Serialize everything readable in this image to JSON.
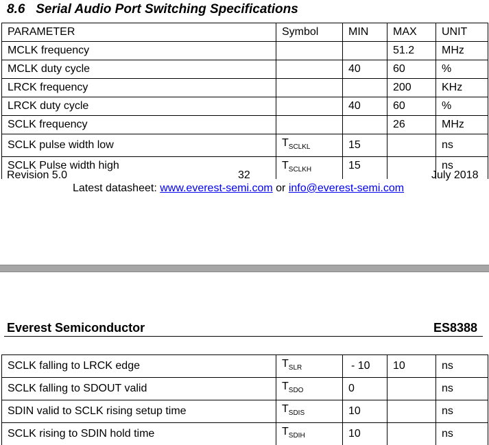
{
  "section_title": "8.6   Serial Audio Port Switching Specifications",
  "columns": [
    "PARAMETER",
    "Symbol",
    "MIN",
    "MAX",
    "UNIT"
  ],
  "top_rows": [
    {
      "param": "MCLK frequency",
      "sym": "",
      "sub": "",
      "min": "",
      "max": "51.2",
      "unit": "MHz"
    },
    {
      "param": "MCLK duty cycle",
      "sym": "",
      "sub": "",
      "min": "40",
      "max": "60",
      "unit": "%"
    },
    {
      "param": "LRCK frequency",
      "sym": "",
      "sub": "",
      "min": "",
      "max": "200",
      "unit": "KHz"
    },
    {
      "param": "LRCK duty cycle",
      "sym": "",
      "sub": "",
      "min": "40",
      "max": "60",
      "unit": "%"
    },
    {
      "param": "SCLK frequency",
      "sym": "",
      "sub": "",
      "min": "",
      "max": "26",
      "unit": "MHz"
    },
    {
      "param": "SCLK pulse width low",
      "sym": "T",
      "sub": "SCLKL",
      "min": "15",
      "max": "",
      "unit": "ns"
    },
    {
      "param": "SCLK Pulse width high",
      "sym": "T",
      "sub": "SCLKH",
      "min": "15",
      "max": "",
      "unit": "ns"
    }
  ],
  "footer": {
    "revision": "Revision 5.0",
    "page": "32",
    "date": "July 2018",
    "latest_prefix": "Latest datasheet: ",
    "website": "www.everest-semi.com",
    "or_text": " or ",
    "email": "info@everest-semi.com"
  },
  "header": {
    "company": "Everest Semiconductor",
    "part": "ES8388"
  },
  "bottom_rows": [
    {
      "param": "SCLK falling to LRCK edge",
      "sym": "T",
      "sub": "SLR",
      "min": "- 10",
      "max": "10",
      "unit": "ns"
    },
    {
      "param": "SCLK falling to SDOUT valid",
      "sym": "T",
      "sub": "SDO",
      "min": "0",
      "max": "",
      "unit": "ns"
    },
    {
      "param": "SDIN valid to SCLK rising setup time",
      "sym": "T",
      "sub": "SDIS",
      "min": "10",
      "max": "",
      "unit": "ns"
    },
    {
      "param": "SCLK rising to SDIN hold time",
      "sym": "T",
      "sub": "SDIH",
      "min": "10",
      "max": "",
      "unit": "ns"
    }
  ]
}
